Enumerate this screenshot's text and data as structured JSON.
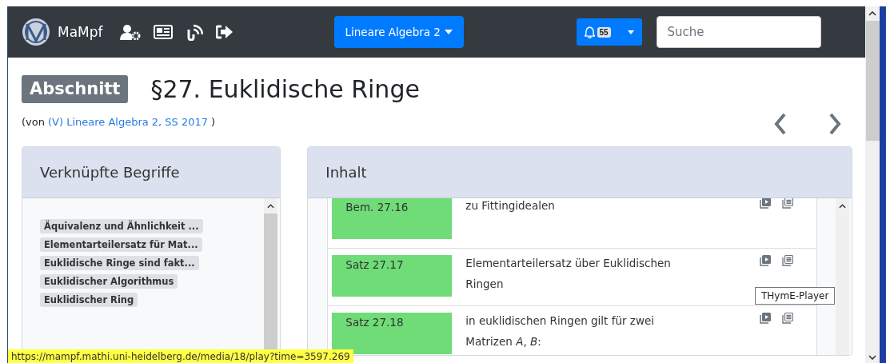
{
  "navbar": {
    "brand": "MaMpf",
    "lecture_dropdown": "Lineare Algebra 2",
    "notifications_count": "55",
    "search": {
      "placeholder": "Suche"
    }
  },
  "header": {
    "badge": "Abschnitt",
    "title": "§27. Euklidische Ringe",
    "source_prefix": "(von",
    "source_link": "(V) Lineare Algebra 2, SS 2017",
    "source_suffix": ")"
  },
  "related_terms": {
    "title": "Verknüpfte Begriffe",
    "tags": [
      "Äquivalenz und Ähnlichkeit ...",
      "Elementarteilersatz für Mat...",
      "Euklidische Ringe sind fakt...",
      "Euklidischer Algorithmus",
      "Euklidischer Ring"
    ]
  },
  "content": {
    "title": "Inhalt",
    "items": [
      {
        "label": "Bem. 27.16",
        "description": "zu Fittingidealen"
      },
      {
        "label": "Satz 27.17",
        "description": "Elementarteilersatz über Euklidischen Ringen"
      },
      {
        "label": "Satz 27.18",
        "description": "in euklidischen Ringen gilt für zwei Matrizen *A*, *B*:"
      }
    ]
  },
  "tooltip": "THymE-Player",
  "status_url": "https://mampf.mathi.uni-heidelberg.de/media/18/play?time=3597.269"
}
